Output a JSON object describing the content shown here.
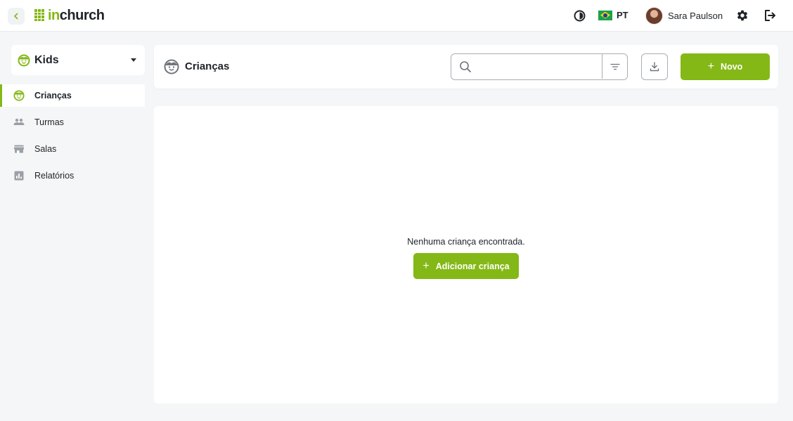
{
  "app": {
    "logo_prefix": "in",
    "logo_suffix": "church",
    "brand_color": "#84b817"
  },
  "topbar": {
    "back_icon": "chevron-left-icon",
    "contrast_icon": "contrast-icon",
    "language": {
      "flag": "brazil-flag-icon",
      "label": "PT"
    },
    "user": {
      "name": "Sara Paulson",
      "avatar": "avatar"
    },
    "settings_icon": "gear-icon",
    "logout_icon": "logout-icon"
  },
  "module": {
    "label": "Kids",
    "icon": "child-face-icon"
  },
  "sidebar": {
    "items": [
      {
        "label": "Crianças",
        "icon": "child-face-icon",
        "active": true
      },
      {
        "label": "Turmas",
        "icon": "group-icon",
        "active": false
      },
      {
        "label": "Salas",
        "icon": "room-icon",
        "active": false
      },
      {
        "label": "Relatórios",
        "icon": "report-icon",
        "active": false
      }
    ]
  },
  "header": {
    "title": "Crianças",
    "icon": "child-face-icon",
    "search": {
      "value": "",
      "placeholder": ""
    },
    "filter_icon": "filter-icon",
    "download_icon": "download-icon",
    "new_label": "Novo"
  },
  "main": {
    "empty_message": "Nenhuma criança encontrada.",
    "add_label": "Adicionar criança"
  }
}
